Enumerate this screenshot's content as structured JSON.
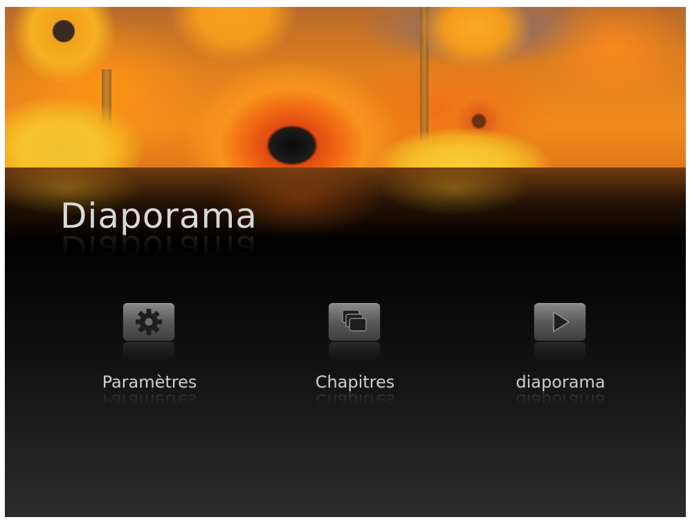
{
  "app": {
    "title": "Diaporama"
  },
  "menu": {
    "items": [
      {
        "label": "Paramètres",
        "icon": "gear-icon"
      },
      {
        "label": "Chapitres",
        "icon": "stacked-windows-icon"
      },
      {
        "label": "diaporama",
        "icon": "play-icon"
      }
    ]
  },
  "colors": {
    "banner_accent": "#f08a1c",
    "background": "#000000",
    "text": "#cfcfcf"
  }
}
